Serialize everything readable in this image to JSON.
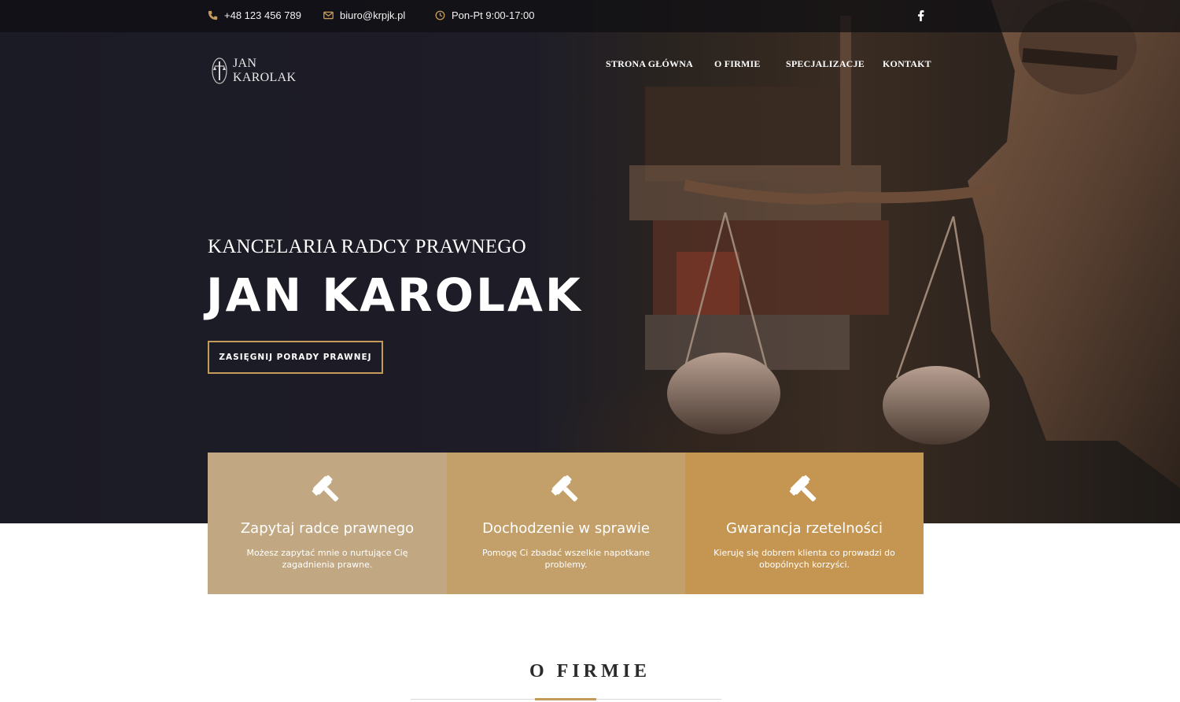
{
  "topbar": {
    "phone": "+48 123 456 789",
    "email": "biuro@krpjk.pl",
    "hours": "Pon-Pt 9:00-17:00",
    "accent_color": "#c59b59"
  },
  "logo": {
    "line1": "JAN",
    "line2": "KAROLAK"
  },
  "nav": {
    "items": [
      {
        "label": "STRONA GŁÓWNA"
      },
      {
        "label": "O FIRMIE"
      },
      {
        "label": "SPECJALIZACJE"
      },
      {
        "label": "KONTAKT"
      }
    ]
  },
  "hero": {
    "subtitle": "KANCELARIA RADCY PRAWNEGO",
    "title": "JAN KAROLAK",
    "cta_label": "ZASIĘGNIJ PORADY PRAWNEJ"
  },
  "features": [
    {
      "title": "Zapytaj radce prawnego",
      "text": "Możesz zapytać mnie o nurtujące Cię zagadnienia prawne.",
      "color": "#c1a883"
    },
    {
      "title": "Dochodzenie w sprawie",
      "text": "Pomogę Ci zbadać wszelkie napotkane problemy.",
      "color": "#c39f69"
    },
    {
      "title": "Gwarancja rzetelności",
      "text": "Kieruję się dobrem klienta co prowadzi do obopólnych korzyści.",
      "color": "#c59552"
    }
  ],
  "about": {
    "title": "O FIRMIE"
  }
}
